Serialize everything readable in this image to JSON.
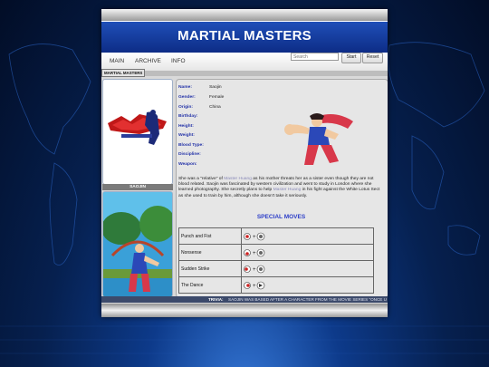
{
  "site": {
    "title": "MARTIAL MASTERS"
  },
  "nav": {
    "items": [
      "MAIN",
      "ARCHIVE",
      "INFO"
    ]
  },
  "search": {
    "placeholder": "Search",
    "start_label": "Start",
    "reset_label": "Reset"
  },
  "breadcrumb": "MARTIAL MASTERS",
  "character": {
    "name": "SAOJIN",
    "fields": [
      {
        "label": "Name:",
        "value": "Saojin"
      },
      {
        "label": "Gender:",
        "value": "Female"
      },
      {
        "label": "Origin:",
        "value": "China"
      },
      {
        "label": "Birthday:",
        "value": ""
      },
      {
        "label": "Height:",
        "value": ""
      },
      {
        "label": "Weight:",
        "value": ""
      },
      {
        "label": "Blood Type:",
        "value": ""
      },
      {
        "label": "Discipline:",
        "value": ""
      },
      {
        "label": "Weapon:",
        "value": ""
      }
    ],
    "description": {
      "p1": "She was a \"relative\" of ",
      "link1": "Master Huang",
      "p2": " as his mother threats her as a sister even though they are not blood related. Saojin was fascinated by western civilization and went to study in London where she learned photography. She secretly plans to help ",
      "link2": "Master Huang",
      "p3": " in his fight against the White Lotus Sect as she used to train by him, although she doesn't take it seriously."
    }
  },
  "moves": {
    "title": "SPECIAL MOVES",
    "rows": [
      {
        "name": "Punch and Fist",
        "input": "→ + punch"
      },
      {
        "name": "Nonsense",
        "input": "↓ + punch"
      },
      {
        "name": "Sudden Strike",
        "input": "← + punch"
      },
      {
        "name": "The Dance",
        "input": "→ + kick"
      }
    ]
  },
  "trivia": {
    "label": "TRIVIA:",
    "text": "SAOJIN WAS BASED AFTER A CHARACTER FROM THE MOVIE SERIES \"ONCE U"
  },
  "colors": {
    "banner": "#1f4fb8",
    "label_blue": "#2433a8",
    "background": "#06204f"
  }
}
